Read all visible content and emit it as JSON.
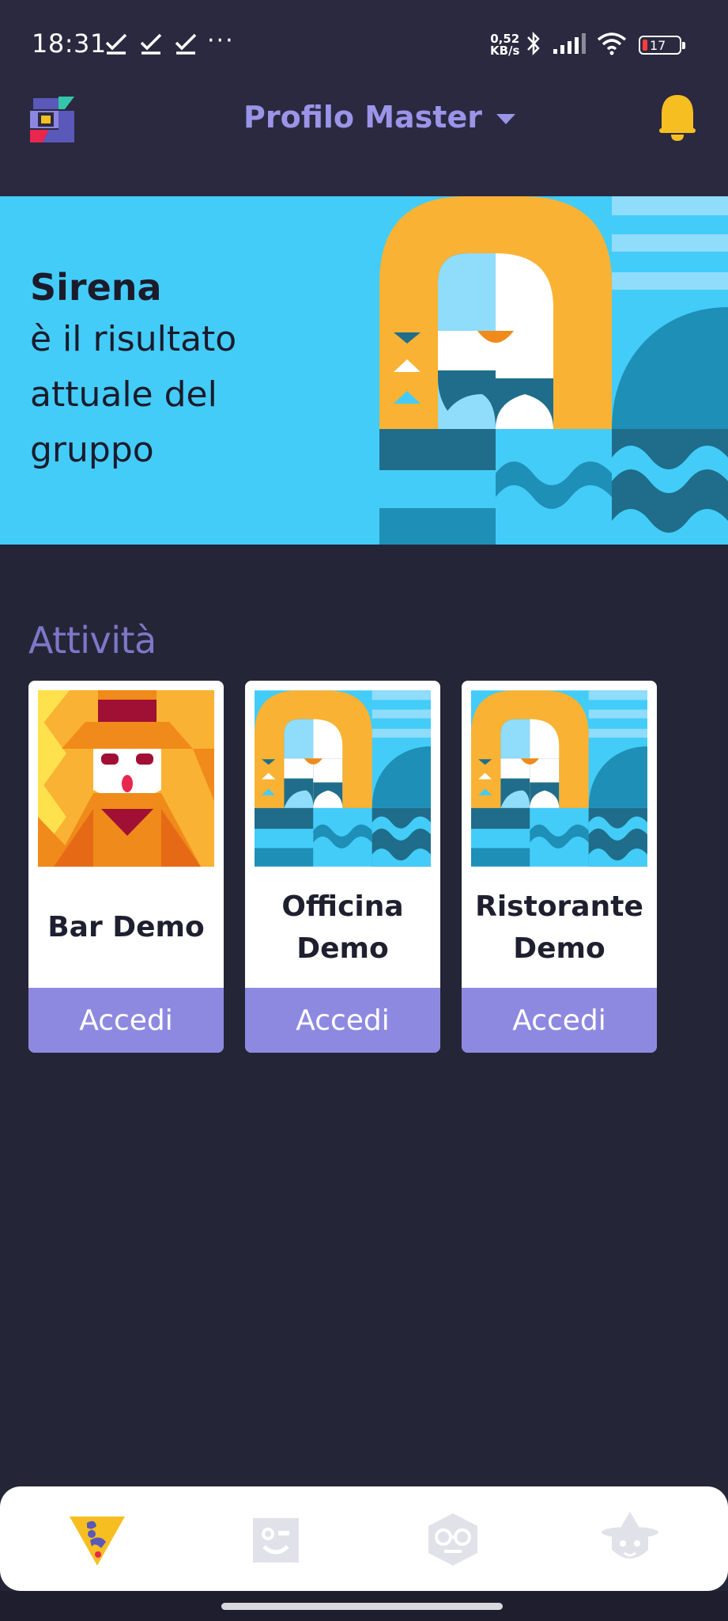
{
  "status_bar": {
    "time": "18:31",
    "dots": "···",
    "speed_value": "0,52",
    "speed_unit": "KB/s",
    "battery": "17"
  },
  "header": {
    "profile_label": "Profilo Master"
  },
  "hero": {
    "title": "Sirena",
    "subtitle": "è il risultato\nattuale del\ngruppo"
  },
  "activities": {
    "title": "Attività",
    "cards": [
      {
        "name": "Bar Demo",
        "button": "Accedi"
      },
      {
        "name": "Officina Demo",
        "button": "Accedi"
      },
      {
        "name": "Ristorante Demo",
        "button": "Accedi"
      }
    ]
  },
  "colors": {
    "background": "#252538",
    "accent": "#8e89e0",
    "hero": "#43ccf8",
    "bell": "#f7be22"
  },
  "icons": {
    "logo": "app-logo-icon",
    "bell": "bell-icon",
    "nav": [
      "nav-home-icon",
      "nav-face-icon",
      "nav-glasses-icon",
      "nav-wizard-icon"
    ]
  }
}
